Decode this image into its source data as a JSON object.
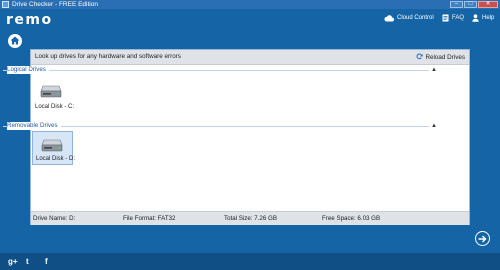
{
  "window": {
    "title": "Drive Checker - FREE Edition",
    "minimize_glyph": "–",
    "maximize_glyph": "□",
    "close_glyph": "✕"
  },
  "header": {
    "logo": "remo",
    "cloud_control": "Cloud Control",
    "faq": "FAQ",
    "help": "Help"
  },
  "panel": {
    "title": "Look up drives for any hardware and software errors",
    "reload": "Reload Drives",
    "sections": {
      "logical": {
        "label": "Logical Drives",
        "toggle": "▲",
        "drives": [
          {
            "label": "Local Disk - C:",
            "selected": false
          }
        ]
      },
      "removable": {
        "label": "Removable Drives",
        "toggle": "▲",
        "drives": [
          {
            "label": "Local Disk - D:",
            "selected": true
          }
        ]
      }
    }
  },
  "status": {
    "drive_name": "Drive Name: D:",
    "file_format": "File Format: FAT32",
    "total_size": "Total Size: 7.26 GB",
    "free_space": "Free Space: 6.03 GB"
  },
  "footer": {
    "gplus": "g+",
    "twitter": "t",
    "facebook": "f"
  },
  "icons": {
    "home": "home-icon",
    "cloud": "cloud-icon",
    "faq": "faq-icon",
    "help": "person-icon",
    "reload": "reload-icon",
    "next": "arrow-right-icon",
    "drive": "hard-disk-icon"
  },
  "colors": {
    "background": "#1565a6",
    "titlebar": "#2a6fb3",
    "footer": "#0f4f86",
    "section_label": "#2459a8",
    "selected_drive": "#d6e6f7"
  }
}
